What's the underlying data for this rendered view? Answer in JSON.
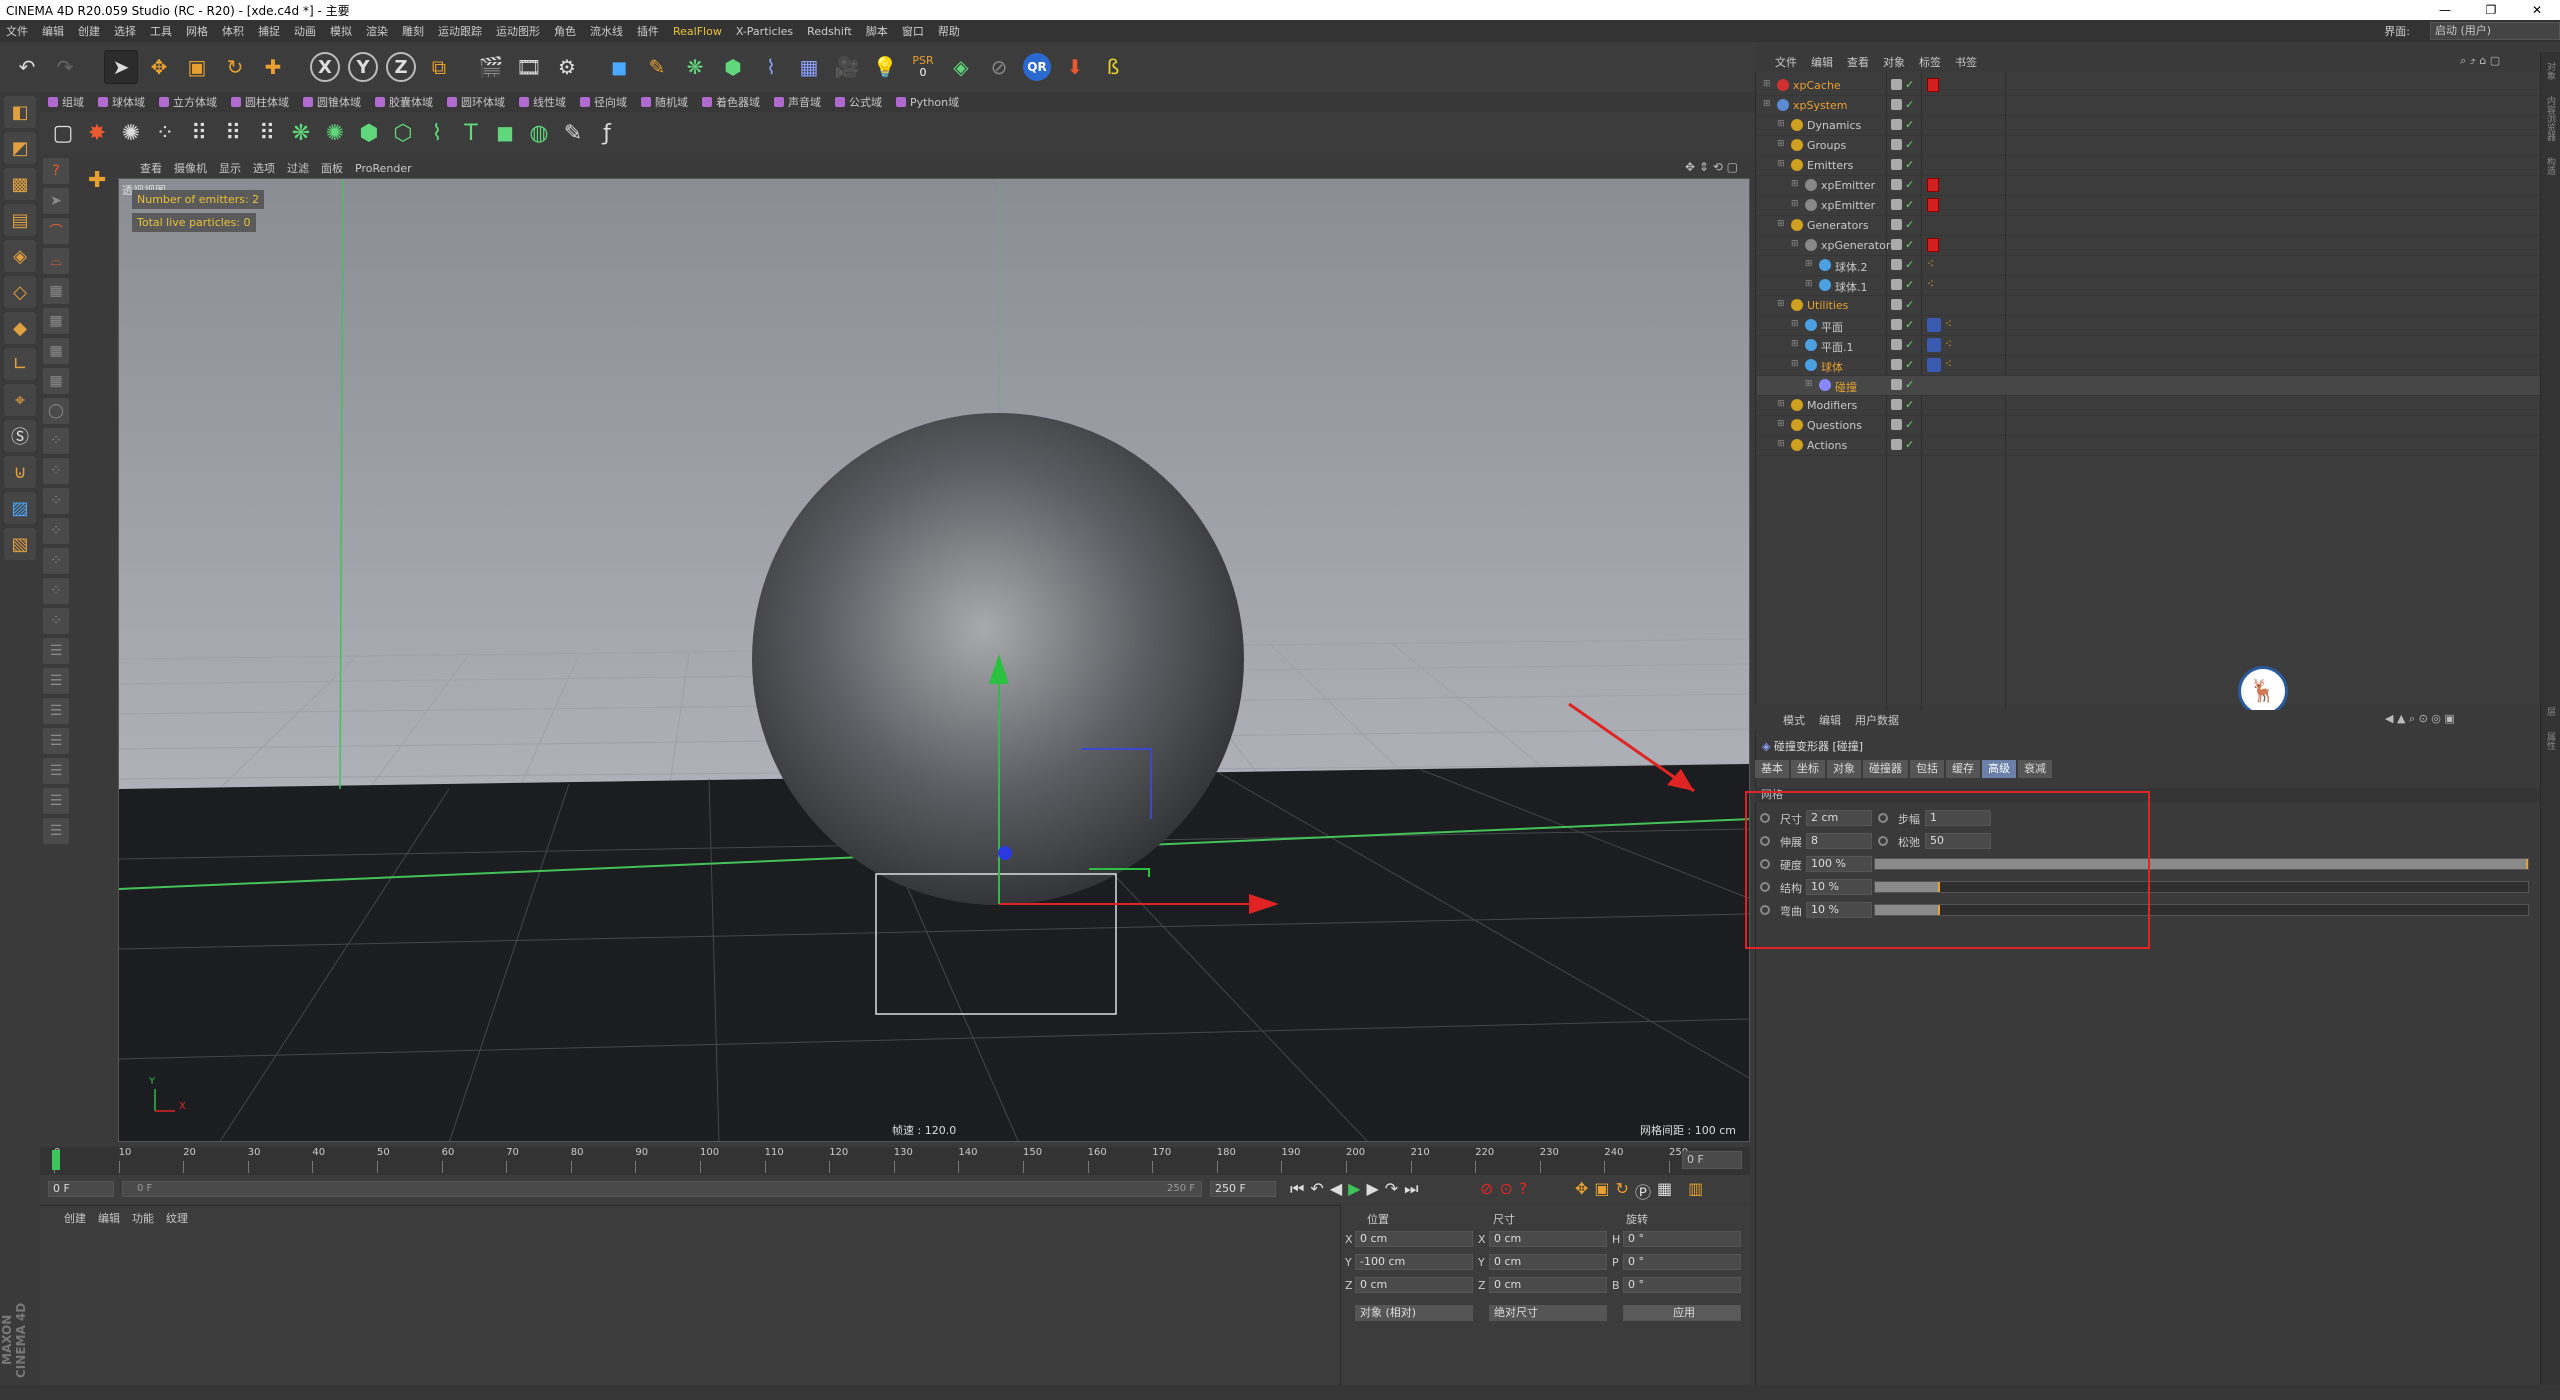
{
  "title": "CINEMA 4D R20.059 Studio (RC - R20) - [xde.c4d *] - 主要",
  "window_controls": [
    "—",
    "❐",
    "✕"
  ],
  "menu": [
    "文件",
    "编辑",
    "创建",
    "选择",
    "工具",
    "网格",
    "体积",
    "捕捉",
    "动画",
    "模拟",
    "渲染",
    "雕刻",
    "运动跟踪",
    "运动图形",
    "角色",
    "流水线",
    "插件",
    "RealFlow",
    "X-Particles",
    "Redshift",
    "脚本",
    "窗口",
    "帮助"
  ],
  "interface": {
    "label": "界面:",
    "value": "启动 (用户)"
  },
  "toolbar2": [
    {
      "label": "组域",
      "color": "#b06ad0"
    },
    {
      "label": "球体域",
      "color": "#b06ad0"
    },
    {
      "label": "立方体域",
      "color": "#b06ad0"
    },
    {
      "label": "圆柱体域",
      "color": "#b06ad0"
    },
    {
      "label": "圆锥体域",
      "color": "#b06ad0"
    },
    {
      "label": "胶囊体域",
      "color": "#b06ad0"
    },
    {
      "label": "圆环体域",
      "color": "#b06ad0"
    },
    {
      "label": "线性域",
      "color": "#b06ad0"
    },
    {
      "label": "径向域",
      "color": "#b06ad0"
    },
    {
      "label": "随机域",
      "color": "#b06ad0"
    },
    {
      "label": "着色器域",
      "color": "#b06ad0"
    },
    {
      "label": "声音域",
      "color": "#b06ad0"
    },
    {
      "label": "公式域",
      "color": "#b06ad0"
    },
    {
      "label": "Python域",
      "color": "#b06ad0"
    }
  ],
  "toolbar1_psr": "PSR",
  "toolbar1_psr_val": "0",
  "toolbar1_qr": "QR",
  "viewport_menu": [
    "查看",
    "摄像机",
    "显示",
    "选项",
    "过滤",
    "面板",
    "ProRender"
  ],
  "viewport_name": "透视视图",
  "hud": {
    "emitters": "Number of emitters: 2",
    "particles": "Total live particles: 0"
  },
  "frame_rate": "帧速 : 120.0",
  "grid_spacing": "网格间距 : 100 cm",
  "axis": {
    "y": "Y",
    "x": "X"
  },
  "timeline": {
    "ticks": [
      "0",
      "10",
      "20",
      "30",
      "40",
      "50",
      "60",
      "70",
      "80",
      "90",
      "100",
      "110",
      "120",
      "130",
      "140",
      "150",
      "160",
      "170",
      "180",
      "190",
      "200",
      "210",
      "220",
      "230",
      "240",
      "250"
    ],
    "current": "0 F",
    "start": "0 F",
    "range_start": "0 F",
    "range_end": "250 F",
    "end": "250 F"
  },
  "mat_menu": [
    "创建",
    "编辑",
    "功能",
    "纹理"
  ],
  "coords": {
    "headers": [
      "位置",
      "尺寸",
      "旋转"
    ],
    "rows": [
      {
        "a": "X",
        "p": "0 cm",
        "b": "X",
        "s": "0 cm",
        "c": "H",
        "r": "0 °"
      },
      {
        "a": "Y",
        "p": "-100 cm",
        "b": "Y",
        "s": "0 cm",
        "c": "P",
        "r": "0 °"
      },
      {
        "a": "Z",
        "p": "0 cm",
        "b": "Z",
        "s": "0 cm",
        "c": "B",
        "r": "0 °"
      }
    ],
    "mode": "对象 (相对)",
    "size_mode": "绝对尺寸",
    "apply": "应用"
  },
  "obj_menu": [
    "文件",
    "编辑",
    "查看",
    "对象",
    "标签",
    "书签"
  ],
  "objects": [
    {
      "name": "xpCache",
      "color": "#e8a030",
      "icon": "#d03030",
      "indent": 0,
      "tag": "red"
    },
    {
      "name": "xpSystem",
      "color": "#e8a030",
      "icon": "#5a8ad0",
      "indent": 0,
      "tag": ""
    },
    {
      "name": "Dynamics",
      "color": "#c8c8c8",
      "icon": "#d0a020",
      "indent": 1,
      "tag": ""
    },
    {
      "name": "Groups",
      "color": "#c8c8c8",
      "icon": "#d0a020",
      "indent": 1,
      "tag": ""
    },
    {
      "name": "Emitters",
      "color": "#c8c8c8",
      "icon": "#d0a020",
      "indent": 1,
      "tag": ""
    },
    {
      "name": "xpEmitter",
      "color": "#c8c8c8",
      "icon": "#888",
      "indent": 2,
      "tag": "red"
    },
    {
      "name": "xpEmitter",
      "color": "#c8c8c8",
      "icon": "#888",
      "indent": 2,
      "tag": "red"
    },
    {
      "name": "Generators",
      "color": "#c8c8c8",
      "icon": "#d0a020",
      "indent": 1,
      "tag": ""
    },
    {
      "name": "xpGenerator",
      "color": "#c8c8c8",
      "icon": "#888",
      "indent": 2,
      "tag": "red"
    },
    {
      "name": "球体.2",
      "color": "#c8c8c8",
      "icon": "#4aa0e0",
      "indent": 3,
      "tag": "dots"
    },
    {
      "name": "球体.1",
      "color": "#c8c8c8",
      "icon": "#4aa0e0",
      "indent": 3,
      "tag": "dots"
    },
    {
      "name": "Utilities",
      "color": "#e8a030",
      "icon": "#d0a020",
      "indent": 1,
      "tag": ""
    },
    {
      "name": "平面",
      "color": "#c8c8c8",
      "icon": "#4aa0e0",
      "indent": 2,
      "tag": "multi"
    },
    {
      "name": "平面.1",
      "color": "#c8c8c8",
      "icon": "#4aa0e0",
      "indent": 2,
      "tag": "multi"
    },
    {
      "name": "球体",
      "color": "#e8a030",
      "icon": "#4aa0e0",
      "indent": 2,
      "tag": "multi"
    },
    {
      "name": "碰撞",
      "color": "#e8a030",
      "icon": "#8888ff",
      "indent": 3,
      "tag": "",
      "selected": true
    },
    {
      "name": "Modifiers",
      "color": "#c8c8c8",
      "icon": "#d0a020",
      "indent": 1,
      "tag": ""
    },
    {
      "name": "Questions",
      "color": "#c8c8c8",
      "icon": "#d0a020",
      "indent": 1,
      "tag": ""
    },
    {
      "name": "Actions",
      "color": "#c8c8c8",
      "icon": "#d0a020",
      "indent": 1,
      "tag": ""
    }
  ],
  "attr_menu": [
    "模式",
    "编辑",
    "用户数据"
  ],
  "attr_title": "碰撞变形器 [碰撞]",
  "attr_tabs": [
    "基本",
    "坐标",
    "对象",
    "碰撞器",
    "包括",
    "缓存",
    "高级",
    "衰减"
  ],
  "attr_active_tab": "高级",
  "attr_section": "网格",
  "params": {
    "size_label": "尺寸",
    "size_val": "2 cm",
    "steps_label": "步幅",
    "steps_val": "1",
    "stretch_label": "伸展",
    "stretch_val": "8",
    "relax_label": "松弛",
    "relax_val": "50",
    "hard_label": "硬度",
    "hard_val": "100 %",
    "hard_frac": 1.0,
    "struct_label": "结构",
    "struct_val": "10 %",
    "struct_frac": 0.1,
    "bend_label": "弯曲",
    "bend_val": "10 %",
    "bend_frac": 0.1
  },
  "right_strip": [
    "对象",
    "内容浏览器",
    "构造",
    "层",
    "属性"
  ]
}
